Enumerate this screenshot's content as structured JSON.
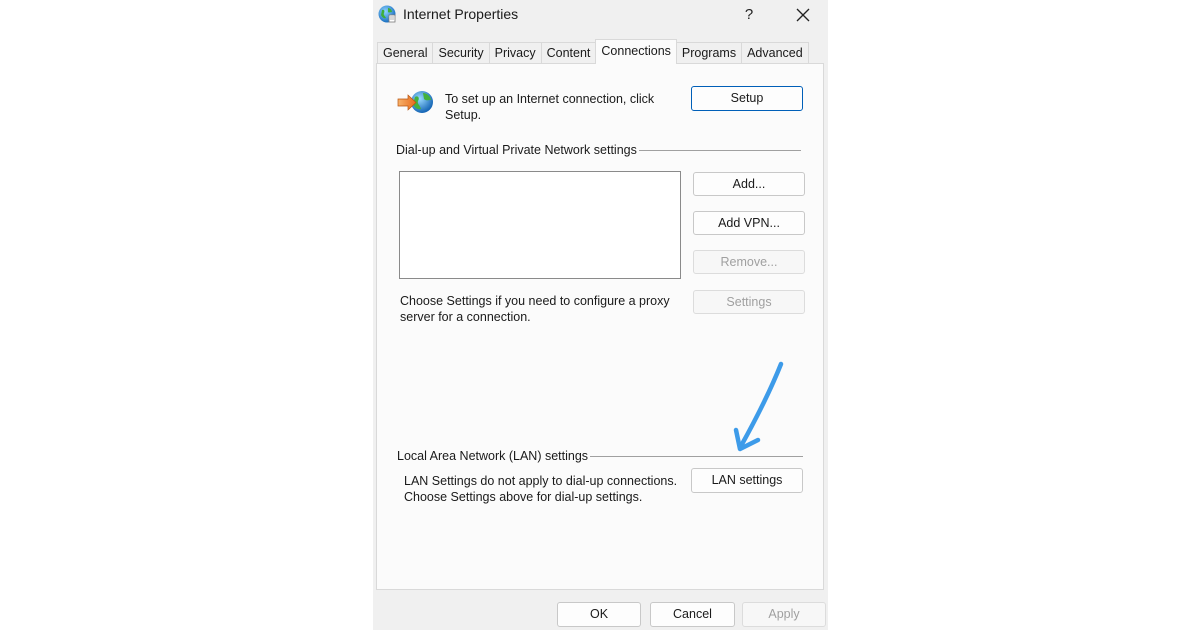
{
  "window": {
    "title": "Internet Properties",
    "help_label": "?",
    "close_icon": "close-icon",
    "app_icon": "globe-icon"
  },
  "tabs": [
    {
      "label": "General",
      "active": false
    },
    {
      "label": "Security",
      "active": false
    },
    {
      "label": "Privacy",
      "active": false
    },
    {
      "label": "Content",
      "active": false
    },
    {
      "label": "Connections",
      "active": true
    },
    {
      "label": "Programs",
      "active": false
    },
    {
      "label": "Advanced",
      "active": false
    }
  ],
  "setup": {
    "icon": "network-setup-icon",
    "text": "To set up an Internet connection, click Setup.",
    "button_label": "Setup"
  },
  "dialup": {
    "group_label": "Dial-up and Virtual Private Network settings",
    "add_label": "Add...",
    "add_vpn_label": "Add VPN...",
    "remove_label": "Remove...",
    "settings_label": "Settings",
    "proxy_text": "Choose Settings if you need to configure a proxy server for a connection."
  },
  "lan": {
    "group_label": "Local Area Network (LAN) settings",
    "text": "LAN Settings do not apply to dial-up connections. Choose Settings above for dial-up settings.",
    "button_label": "LAN settings"
  },
  "footer": {
    "ok_label": "OK",
    "cancel_label": "Cancel",
    "apply_label": "Apply"
  },
  "colors": {
    "accent": "#005fb8",
    "annotation_arrow": "#3d9be9"
  }
}
